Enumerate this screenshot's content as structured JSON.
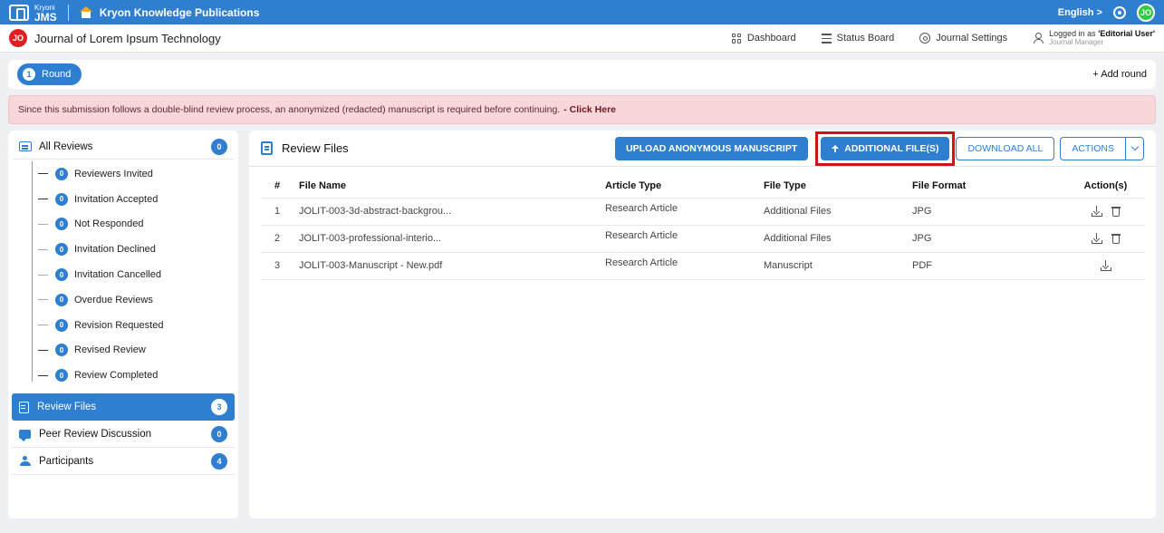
{
  "app": {
    "logo_small": "Kryoni",
    "logo_big": "JMS",
    "publisher": "Kryon Knowledge Publications",
    "language": "English >",
    "user_initials": "JO"
  },
  "journal": {
    "initials": "JO",
    "name": "Journal of Lorem Ipsum Technology",
    "nav": [
      {
        "label": "Dashboard",
        "icon": "grid-icon"
      },
      {
        "label": "Status Board",
        "icon": "board-icon"
      },
      {
        "label": "Journal Settings",
        "icon": "gear-icon"
      }
    ],
    "login_prefix": "Logged in as ",
    "login_user": "'Editorial User'",
    "login_role": "Journal Manager"
  },
  "round": {
    "number": "1",
    "label": "Round",
    "add_label": "+ Add round"
  },
  "alert": {
    "message": "Since this submission follows a double-blind review process, an anonymized (redacted) manuscript is required before continuing.",
    "link": "- Click Here"
  },
  "sidebar": {
    "all_reviews": {
      "label": "All Reviews",
      "count": "0"
    },
    "sub_items": [
      {
        "label": "Reviewers Invited",
        "count": "0"
      },
      {
        "label": "Invitation Accepted",
        "count": "0"
      },
      {
        "label": "Not Responded",
        "count": "0"
      },
      {
        "label": "Invitation Declined",
        "count": "0"
      },
      {
        "label": "Invitation Cancelled",
        "count": "0"
      },
      {
        "label": "Overdue Reviews",
        "count": "0"
      },
      {
        "label": "Revision Requested",
        "count": "0"
      },
      {
        "label": "Revised Review",
        "count": "0"
      },
      {
        "label": "Review Completed",
        "count": "0"
      }
    ],
    "items": [
      {
        "label": "Review Files",
        "count": "3"
      },
      {
        "label": "Peer Review Discussion",
        "count": "0"
      },
      {
        "label": "Participants",
        "count": "4"
      }
    ]
  },
  "main": {
    "title": "Review Files",
    "buttons": {
      "upload": "UPLOAD ANONYMOUS MANUSCRIPT",
      "additional": "ADDITIONAL FILE(S)",
      "download_all": "DOWNLOAD ALL",
      "actions": "ACTIONS"
    },
    "columns": [
      "#",
      "File Name",
      "Article Type",
      "File Type",
      "File Format",
      "Action(s)"
    ],
    "rows": [
      {
        "num": "1",
        "name": "JOLIT-003-3d-abstract-backgrou...",
        "article_type": "Research Article",
        "file_type": "Additional Files",
        "format": "JPG"
      },
      {
        "num": "2",
        "name": "JOLIT-003-professional-interio...",
        "article_type": "Research Article",
        "file_type": "Additional Files",
        "format": "JPG"
      },
      {
        "num": "3",
        "name": "JOLIT-003-Manuscript - New.pdf",
        "article_type": "Research Article",
        "file_type": "Manuscript",
        "format": "PDF"
      }
    ]
  },
  "colors": {
    "primary": "#2f7fd1",
    "alert_bg": "#f8d7da",
    "highlight": "#d0121b",
    "avatar_green": "#2ecc40",
    "journal_badge": "#e02020"
  }
}
